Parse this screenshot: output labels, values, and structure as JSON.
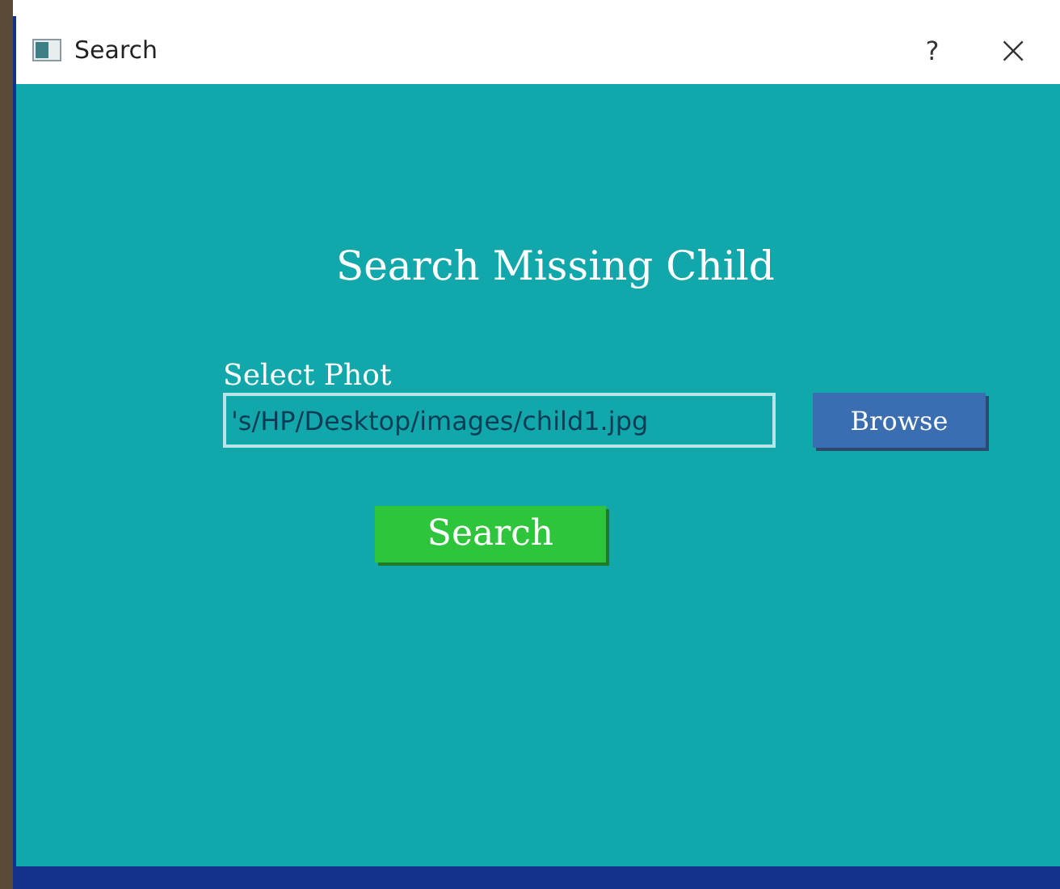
{
  "window": {
    "title": "Search",
    "help": "?",
    "close": "×"
  },
  "heading": "Search Missing Child",
  "photo": {
    "label": "Select Phot",
    "value": "'s/HP/Desktop/images/child1.jpg"
  },
  "buttons": {
    "browse": "Browse",
    "search": "Search"
  }
}
